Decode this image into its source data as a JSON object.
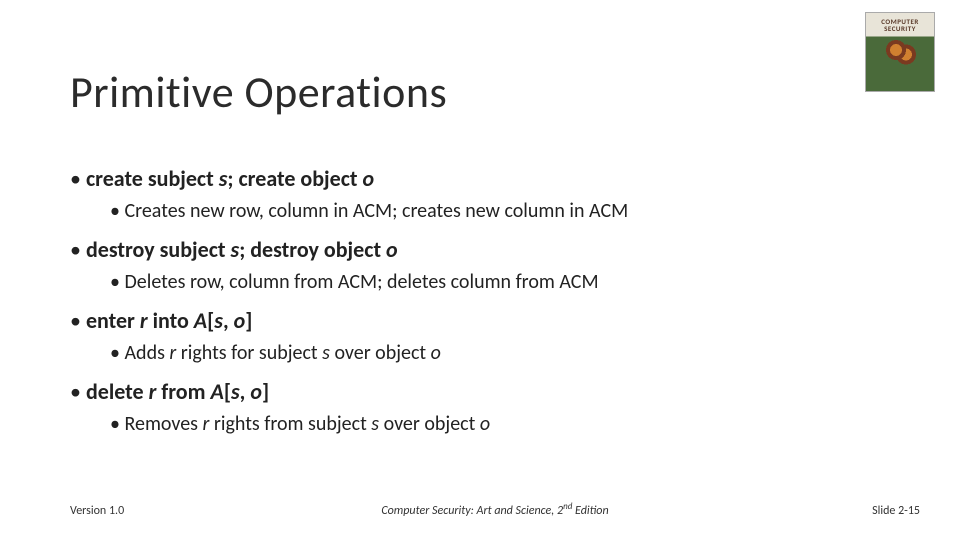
{
  "title": "Primitive Operations",
  "logo": {
    "line1": "COMPUTER",
    "line2": "SECURITY"
  },
  "bullets": {
    "b1": {
      "pre": "create subject ",
      "s": "s",
      "mid": "; create object ",
      "o": "o",
      "sub": "Creates new row, column in ACM; creates new column in ACM"
    },
    "b2": {
      "pre": "destroy subject ",
      "s": "s",
      "mid": "; destroy object ",
      "o": "o",
      "sub": "Deletes row, column from ACM; deletes column from ACM"
    },
    "b3": {
      "pre": "enter ",
      "r": "r",
      "mid1": " into ",
      "A": "A",
      "br1": "[",
      "s": "s",
      "comma": ", ",
      "o": "o",
      "br2": "]",
      "sub_pre": "Adds ",
      "sub_r": "r",
      "sub_mid1": " rights for subject ",
      "sub_s": "s",
      "sub_mid2": " over object  ",
      "sub_o": "o"
    },
    "b4": {
      "pre": "delete ",
      "r": "r",
      "mid1": " from ",
      "A": "A",
      "br1": "[",
      "s": "s",
      "comma": ", ",
      "o": "o",
      "br2": "]",
      "sub_pre": "Removes ",
      "sub_r": "r",
      "sub_mid1": " rights from subject ",
      "sub_s": "s",
      "sub_mid2": " over object  ",
      "sub_o": "o"
    }
  },
  "footer": {
    "left": "Version 1.0",
    "center_pre": "Computer Security: Art and Science, 2",
    "center_sup": "nd",
    "center_post": " Edition",
    "right": "Slide 2-15"
  }
}
